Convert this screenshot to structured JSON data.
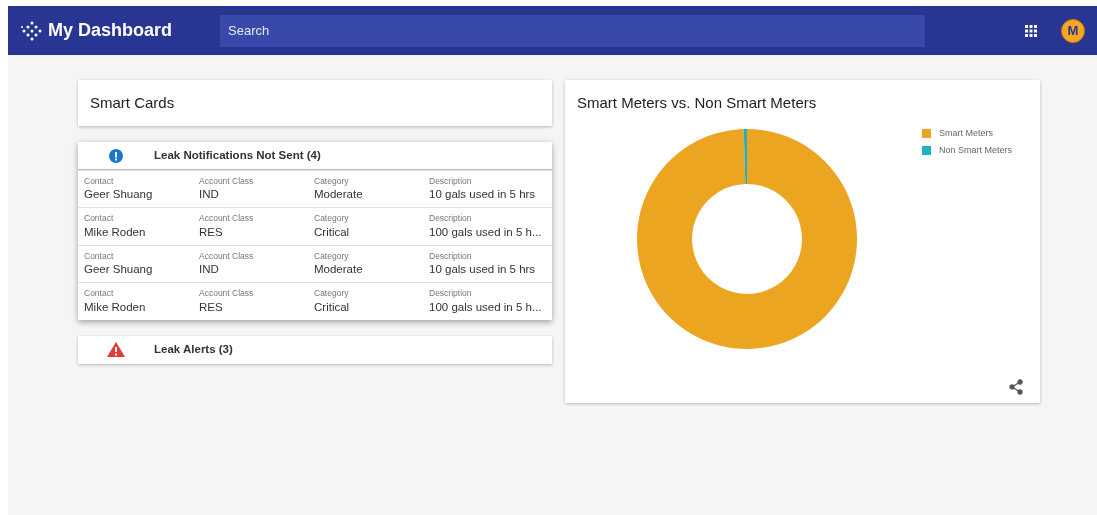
{
  "app_bar": {
    "title": "My Dashboard",
    "search": {
      "placeholder": "Search"
    },
    "avatar": "M"
  },
  "smart_cards": {
    "title": "Smart Cards",
    "sections": [
      {
        "kind": "info",
        "title": "Leak Notifications Not Sent (4)",
        "expanded": true,
        "rows": [
          [
            {
              "label": "Contact",
              "value": "Geer Shuang"
            },
            {
              "label": "Account Class",
              "value": "IND"
            },
            {
              "label": "Category",
              "value": "Moderate"
            },
            {
              "label": "Description",
              "value": "10 gals used in 5 hrs"
            }
          ],
          [
            {
              "label": "Contact",
              "value": "Mike Roden"
            },
            {
              "label": "Account Class",
              "value": "RES"
            },
            {
              "label": "Category",
              "value": "Critical"
            },
            {
              "label": "Description",
              "value": "100 gals used in 5 h..."
            }
          ],
          [
            {
              "label": "Contact",
              "value": "Geer Shuang"
            },
            {
              "label": "Account Class",
              "value": "IND"
            },
            {
              "label": "Category",
              "value": "Moderate"
            },
            {
              "label": "Description",
              "value": "10 gals used in 5 hrs"
            }
          ],
          [
            {
              "label": "Contact",
              "value": "Mike Roden"
            },
            {
              "label": "Account Class",
              "value": "RES"
            },
            {
              "label": "Category",
              "value": "Critical"
            },
            {
              "label": "Description",
              "value": "100 gals used in 5 h..."
            }
          ]
        ]
      },
      {
        "kind": "alert",
        "title": "Leak Alerts (3)",
        "expanded": false
      }
    ]
  },
  "meters_card": {
    "title": "Smart Meters vs. Non Smart Meters",
    "legend": [
      {
        "label": "Smart Meters",
        "color": "#eca520"
      },
      {
        "label": "Non Smart Meters",
        "color": "#1fb1c4"
      }
    ]
  }
}
